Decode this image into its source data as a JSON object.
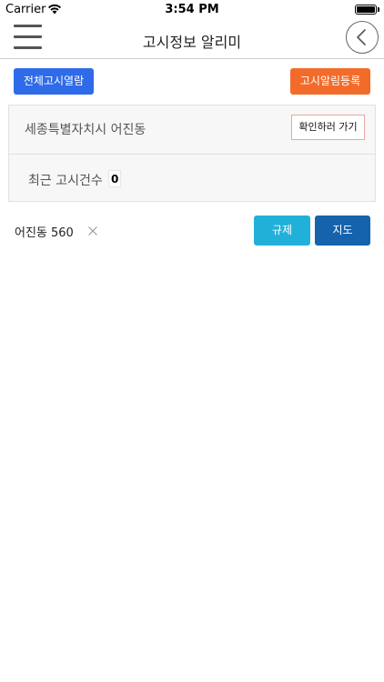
{
  "status_bar": {
    "carrier": "Carrier",
    "time": "3:54 PM",
    "wifi_icon": "wifi-icon",
    "battery_icon": "battery-icon"
  },
  "header": {
    "title": "고시정보 알리미",
    "menu_icon": "hamburger-menu-icon",
    "back_icon": "chevron-left-icon"
  },
  "actions": {
    "view_all_label": "전체고시열람",
    "register_alert_label": "고시알림등록"
  },
  "panel": {
    "location": "세종특별자치시 어진동",
    "confirm_label": "확인하러 가기",
    "recent_count_label": "최근 고시건수",
    "recent_count_value": "0"
  },
  "address_row": {
    "address": "어진동 560",
    "regulation_label": "규제",
    "map_label": "지도"
  },
  "colors": {
    "view_all_bg": "#2f6be8",
    "register_bg": "#f36b2a",
    "regulation_bg": "#21b1d8",
    "map_bg": "#1563ad"
  }
}
